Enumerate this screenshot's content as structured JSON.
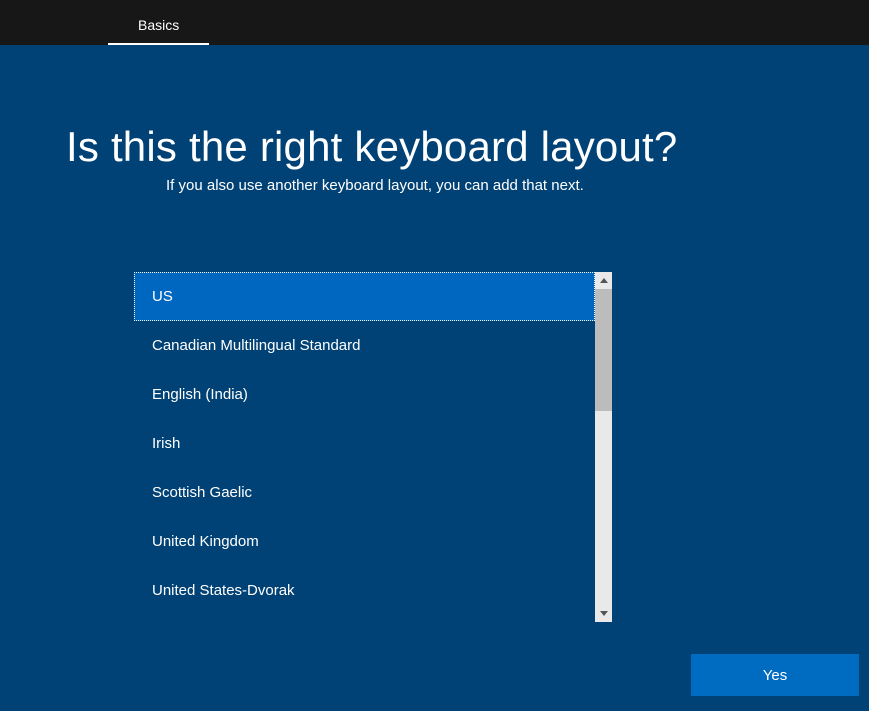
{
  "tab": {
    "label": "Basics"
  },
  "heading": "Is this the right keyboard layout?",
  "subheading": "If you also use another keyboard layout, you can add that next.",
  "layouts": [
    {
      "label": "US",
      "selected": true
    },
    {
      "label": "Canadian Multilingual Standard",
      "selected": false
    },
    {
      "label": "English (India)",
      "selected": false
    },
    {
      "label": "Irish",
      "selected": false
    },
    {
      "label": "Scottish Gaelic",
      "selected": false
    },
    {
      "label": "United Kingdom",
      "selected": false
    },
    {
      "label": "United States-Dvorak",
      "selected": false
    }
  ],
  "button": {
    "yes_label": "Yes"
  }
}
